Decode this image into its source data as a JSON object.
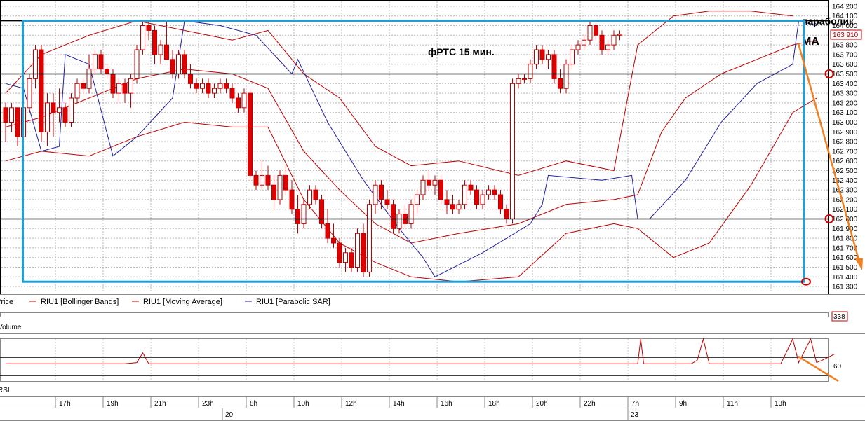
{
  "chart_data": {
    "type": "candlestick",
    "title": "фРТС   15 мин.",
    "annotations": {
      "parabolic": "параболик",
      "ma": "МА"
    },
    "y_ticks": [
      "164 200",
      "164 100",
      "164 000",
      "163 900",
      "163 800",
      "163 700",
      "163 600",
      "163 500",
      "163 400",
      "163 300",
      "163 200",
      "163 100",
      "163 000",
      "162 900",
      "162 800",
      "162 700",
      "162 600",
      "162 500",
      "162 400",
      "162 300",
      "162 200",
      "162 100",
      "162 000",
      "161 900",
      "161 800",
      "161 700",
      "161 600",
      "161 500",
      "161 400",
      "161 300"
    ],
    "ylim": [
      161250,
      164250
    ],
    "current_price": "163 910",
    "volume_value": "338",
    "rsi_level": "60",
    "rsi_ylim": [
      40,
      70
    ],
    "levels": [
      164050,
      163500,
      162000
    ],
    "box": {
      "x_from": 1,
      "x_to": 199,
      "y_from": 161350,
      "y_to": 164050
    },
    "circles": [
      163500,
      162000
    ],
    "legend": [
      {
        "label": "Price",
        "color": "#d40000"
      },
      {
        "label": "RIU1 [Bollinger Bands]",
        "color": "#c00000"
      },
      {
        "label": "RIU1 [Moving Average]",
        "color": "#c00000"
      },
      {
        "label": "RIU1 [Parabolic SAR]",
        "color": "#2020a0"
      }
    ],
    "panel_labels": {
      "volume": "Volume",
      "rsi": "RSI"
    },
    "time_labels": [
      {
        "label": "17h",
        "x": 10
      },
      {
        "label": "19h",
        "x": 18
      },
      {
        "label": "21h",
        "x": 26
      },
      {
        "label": "23h",
        "x": 34
      },
      {
        "label": "8h",
        "x": 42
      },
      {
        "label": "10h",
        "x": 50
      },
      {
        "label": "12h",
        "x": 58
      },
      {
        "label": "14h",
        "x": 66
      },
      {
        "label": "16h",
        "x": 74
      },
      {
        "label": "18h",
        "x": 82
      },
      {
        "label": "20h",
        "x": 90
      },
      {
        "label": "22h",
        "x": 98
      },
      {
        "label": "7h",
        "x": 106
      },
      {
        "label": "9h",
        "x": 114
      },
      {
        "label": "11h",
        "x": 122
      },
      {
        "label": "13h",
        "x": 130
      }
    ],
    "date_labels": [
      {
        "label": "20",
        "x": 38
      },
      {
        "label": "23",
        "x": 106
      }
    ],
    "candles": [
      [
        163150,
        163200,
        162800,
        163000
      ],
      [
        163000,
        163200,
        162900,
        163150
      ],
      [
        163150,
        163150,
        162750,
        162850
      ],
      [
        162850,
        163200,
        162600,
        163150
      ],
      [
        163150,
        163500,
        163100,
        163450
      ],
      [
        163450,
        163800,
        163350,
        163750
      ],
      [
        163750,
        163800,
        162800,
        162900
      ],
      [
        162900,
        163300,
        162750,
        163200
      ],
      [
        163200,
        163300,
        162850,
        163100
      ],
      [
        163100,
        163350,
        163000,
        163150
      ],
      [
        163150,
        163200,
        162950,
        163000
      ],
      [
        163000,
        163300,
        162950,
        163250
      ],
      [
        163250,
        163450,
        163200,
        163400
      ],
      [
        163400,
        163450,
        163300,
        163350
      ],
      [
        163350,
        163700,
        163300,
        163550
      ],
      [
        163550,
        163750,
        163500,
        163700
      ],
      [
        163700,
        163750,
        163500,
        163550
      ],
      [
        163550,
        163600,
        163450,
        163500
      ],
      [
        163500,
        163550,
        163250,
        163300
      ],
      [
        163300,
        163450,
        163200,
        163400
      ],
      [
        163400,
        163450,
        163200,
        163300
      ],
      [
        163300,
        163500,
        163150,
        163450
      ],
      [
        163450,
        163800,
        163400,
        163750
      ],
      [
        163750,
        164050,
        163700,
        164000
      ],
      [
        164000,
        164050,
        163850,
        163950
      ],
      [
        163950,
        164000,
        163600,
        163700
      ],
      [
        163700,
        163850,
        163600,
        163800
      ],
      [
        163800,
        164050,
        163700,
        163650
      ],
      [
        163650,
        163750,
        163450,
        163500
      ],
      [
        163500,
        163750,
        163450,
        163700
      ],
      [
        163700,
        163750,
        163450,
        163500
      ],
      [
        163500,
        163600,
        163350,
        163400
      ],
      [
        163400,
        163450,
        163300,
        163350
      ],
      [
        163350,
        163450,
        163300,
        163400
      ],
      [
        163400,
        163450,
        163250,
        163300
      ],
      [
        163300,
        163400,
        163250,
        163350
      ],
      [
        163350,
        163450,
        163300,
        163400
      ],
      [
        163400,
        163450,
        163300,
        163350
      ],
      [
        163350,
        163400,
        163200,
        163250
      ],
      [
        163250,
        163300,
        163100,
        163150
      ],
      [
        163150,
        163350,
        163100,
        163300
      ],
      [
        163300,
        163350,
        162400,
        162450
      ],
      [
        162450,
        162500,
        162300,
        162350
      ],
      [
        162350,
        162600,
        162300,
        162450
      ],
      [
        162450,
        162550,
        162300,
        162350
      ],
      [
        162350,
        162450,
        162100,
        162200
      ],
      [
        162200,
        162500,
        162150,
        162450
      ],
      [
        162450,
        162550,
        162250,
        162300
      ],
      [
        162300,
        162400,
        162050,
        162100
      ],
      [
        162100,
        162250,
        161850,
        161950
      ],
      [
        161950,
        162200,
        161900,
        162150
      ],
      [
        162150,
        162350,
        162100,
        162300
      ],
      [
        162300,
        162350,
        162150,
        162200
      ],
      [
        162200,
        162250,
        161900,
        161950
      ],
      [
        161950,
        162100,
        161750,
        161800
      ],
      [
        161800,
        161950,
        161700,
        161750
      ],
      [
        161750,
        161800,
        161500,
        161550
      ],
      [
        161550,
        161700,
        161450,
        161650
      ],
      [
        161650,
        161700,
        161450,
        161500
      ],
      [
        161500,
        161900,
        161450,
        161850
      ],
      [
        161850,
        161950,
        161400,
        161450
      ],
      [
        161450,
        162200,
        161400,
        162150
      ],
      [
        162150,
        162400,
        162050,
        162350
      ],
      [
        162350,
        162400,
        162100,
        162200
      ],
      [
        162200,
        162300,
        162100,
        162150
      ],
      [
        162150,
        162200,
        161850,
        161900
      ],
      [
        161900,
        162100,
        161850,
        162050
      ],
      [
        162050,
        162150,
        161900,
        161950
      ],
      [
        161950,
        162200,
        161900,
        162150
      ],
      [
        162150,
        162300,
        162050,
        162250
      ],
      [
        162250,
        162450,
        162200,
        162400
      ],
      [
        162400,
        162500,
        162300,
        162350
      ],
      [
        162350,
        162450,
        162250,
        162400
      ],
      [
        162400,
        162450,
        162150,
        162200
      ],
      [
        162200,
        162300,
        162050,
        162150
      ],
      [
        162150,
        162250,
        162050,
        162100
      ],
      [
        162100,
        162200,
        162050,
        162150
      ],
      [
        162150,
        162400,
        162100,
        162350
      ],
      [
        162350,
        162400,
        162250,
        162300
      ],
      [
        162300,
        162350,
        162100,
        162150
      ],
      [
        162150,
        162300,
        162100,
        162250
      ],
      [
        162250,
        162350,
        162200,
        162300
      ],
      [
        162300,
        162350,
        162200,
        162250
      ],
      [
        162250,
        162300,
        162050,
        162100
      ],
      [
        162100,
        162150,
        161950,
        162000
      ],
      [
        162000,
        163450,
        161950,
        163400
      ],
      [
        163400,
        163500,
        163350,
        163450
      ],
      [
        163450,
        163500,
        163400,
        163450
      ],
      [
        163450,
        163650,
        163400,
        163600
      ],
      [
        163600,
        163800,
        163550,
        163750
      ],
      [
        163750,
        163800,
        163600,
        163650
      ],
      [
        163650,
        163750,
        163550,
        163700
      ],
      [
        163700,
        163750,
        163400,
        163450
      ],
      [
        163450,
        163550,
        163300,
        163350
      ],
      [
        163350,
        163650,
        163300,
        163600
      ],
      [
        163600,
        163800,
        163550,
        163750
      ],
      [
        163750,
        163850,
        163700,
        163800
      ],
      [
        163800,
        163900,
        163750,
        163850
      ],
      [
        163850,
        164050,
        163800,
        164000
      ],
      [
        164000,
        164050,
        163850,
        163900
      ],
      [
        163900,
        163950,
        163700,
        163750
      ],
      [
        163750,
        163850,
        163700,
        163800
      ],
      [
        163800,
        163950,
        163750,
        163900
      ],
      [
        163900,
        163950,
        163850,
        163910
      ]
    ],
    "bollinger_upper": [
      [
        0,
        163300
      ],
      [
        6,
        163700
      ],
      [
        14,
        163900
      ],
      [
        22,
        164050
      ],
      [
        30,
        163950
      ],
      [
        38,
        163850
      ],
      [
        44,
        163950
      ],
      [
        50,
        163500
      ],
      [
        56,
        163250
      ],
      [
        62,
        162750
      ],
      [
        68,
        162550
      ],
      [
        76,
        162600
      ],
      [
        86,
        162450
      ],
      [
        94,
        162600
      ],
      [
        102,
        162500
      ],
      [
        106,
        163800
      ],
      [
        112,
        164100
      ],
      [
        118,
        164150
      ],
      [
        125,
        164150
      ],
      [
        132,
        164100
      ]
    ],
    "bollinger_lower": [
      [
        0,
        162600
      ],
      [
        6,
        162700
      ],
      [
        14,
        162650
      ],
      [
        22,
        162850
      ],
      [
        30,
        163000
      ],
      [
        38,
        162950
      ],
      [
        44,
        162950
      ],
      [
        50,
        162200
      ],
      [
        56,
        161750
      ],
      [
        62,
        161550
      ],
      [
        68,
        161400
      ],
      [
        76,
        161350
      ],
      [
        86,
        161400
      ],
      [
        94,
        161850
      ],
      [
        102,
        161950
      ],
      [
        106,
        161900
      ],
      [
        112,
        161600
      ],
      [
        118,
        161750
      ],
      [
        125,
        162350
      ],
      [
        132,
        163100
      ],
      [
        136,
        163250
      ]
    ],
    "moving_average": [
      [
        0,
        162950
      ],
      [
        6,
        163050
      ],
      [
        14,
        163250
      ],
      [
        22,
        163450
      ],
      [
        30,
        163550
      ],
      [
        38,
        163500
      ],
      [
        44,
        163350
      ],
      [
        50,
        162700
      ],
      [
        56,
        162300
      ],
      [
        62,
        161950
      ],
      [
        68,
        161750
      ],
      [
        76,
        161850
      ],
      [
        86,
        161950
      ],
      [
        94,
        162150
      ],
      [
        102,
        162200
      ],
      [
        106,
        162250
      ],
      [
        110,
        162900
      ],
      [
        114,
        163250
      ],
      [
        120,
        163500
      ],
      [
        126,
        163650
      ],
      [
        132,
        163800
      ],
      [
        136,
        163850
      ]
    ],
    "parabolic_sar": [
      [
        0,
        163400
      ],
      [
        3,
        163350
      ],
      [
        6,
        162700
      ],
      [
        9,
        162750
      ],
      [
        10,
        163700
      ],
      [
        14,
        163600
      ],
      [
        18,
        162650
      ],
      [
        22,
        162850
      ],
      [
        28,
        163250
      ],
      [
        30,
        164050
      ],
      [
        36,
        164000
      ],
      [
        42,
        163900
      ],
      [
        48,
        163500
      ],
      [
        49,
        163650
      ],
      [
        54,
        163000
      ],
      [
        60,
        162400
      ],
      [
        66,
        161900
      ],
      [
        70,
        161600
      ],
      [
        72,
        161400
      ],
      [
        80,
        161650
      ],
      [
        88,
        161950
      ],
      [
        90,
        162150
      ],
      [
        91,
        162450
      ],
      [
        100,
        162400
      ],
      [
        105,
        162450
      ],
      [
        106,
        162000
      ],
      [
        108,
        162000
      ],
      [
        114,
        162400
      ],
      [
        120,
        163000
      ],
      [
        126,
        163400
      ],
      [
        132,
        163600
      ],
      [
        133,
        164050
      ],
      [
        136,
        164000
      ]
    ],
    "rsi": [
      [
        0,
        50
      ],
      [
        20,
        50
      ],
      [
        22,
        52
      ],
      [
        23,
        68
      ],
      [
        24,
        50
      ],
      [
        80,
        50
      ],
      [
        100,
        50
      ],
      [
        106,
        50
      ],
      [
        106.5,
        95
      ],
      [
        107,
        50
      ],
      [
        115,
        50
      ],
      [
        116,
        56
      ],
      [
        117,
        95
      ],
      [
        118,
        50
      ],
      [
        130,
        50
      ],
      [
        132,
        95
      ],
      [
        133,
        52
      ],
      [
        135,
        95
      ],
      [
        136,
        52
      ],
      [
        137,
        56
      ],
      [
        139,
        66
      ]
    ]
  }
}
